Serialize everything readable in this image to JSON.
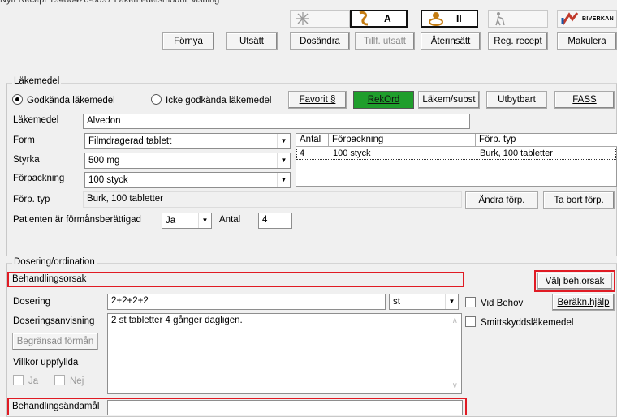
{
  "window": {
    "title": "Nytt Recept 19480420-0097 Läkemedelsmodul, visning"
  },
  "toolbar": {
    "icons": [
      {
        "name": "snowflake-icon",
        "label": ""
      },
      {
        "name": "person-a-icon",
        "label": "A"
      },
      {
        "name": "person-ii-icon",
        "label": "II"
      },
      {
        "name": "walker-icon",
        "label": ""
      },
      {
        "name": "biverkan-logo-icon",
        "label": "BIVERKAN"
      }
    ],
    "buttons": {
      "fornya": "Förnya",
      "utsatt": "Utsätt",
      "dosandra": "Dosändra",
      "tillf_utsatt": "Tillf. utsatt",
      "aterinsatt": "Återinsätt",
      "reg_recept": "Reg. recept",
      "makulera": "Makulera"
    }
  },
  "lakemedel": {
    "legend": "Läkemedel",
    "radio_godkanda": "Godkända läkemedel",
    "radio_icke": "Icke godkända läkemedel",
    "buttons": {
      "favorit": "Favorit §",
      "rekord": "RekOrd",
      "lakem_subst": "Läkem/subst",
      "utbytbart": "Utbytbart",
      "fass": "FASS",
      "andra_forp": "Ändra förp.",
      "ta_bort_forp": "Ta bort förp."
    },
    "labels": {
      "lakemedel": "Läkemedel",
      "form": "Form",
      "styrka": "Styrka",
      "forpackning": "Förpackning",
      "forp_typ": "Förp. typ",
      "formansberattigad": "Patienten är förmånsberättigad",
      "antal": "Antal"
    },
    "values": {
      "lakemedel": "Alvedon",
      "form": "Filmdragerad tablett",
      "styrka": "500 mg",
      "forpackning": "100 styck",
      "forp_typ": "Burk, 100 tabletter",
      "formansberattigad": "Ja",
      "antal": "4"
    },
    "grid": {
      "headers": [
        "Antal",
        "Förpackning",
        "Förp. typ"
      ],
      "rows": [
        [
          "4",
          "100 styck",
          "Burk, 100 tabletter"
        ]
      ]
    }
  },
  "dosering": {
    "legend": "Dosering/ordination",
    "labels": {
      "behandlingsorsak": "Behandlingsorsak",
      "dosering": "Dosering",
      "doseringsanvisning": "Doseringsanvisning",
      "villkor": "Villkor uppfyllda",
      "ja": "Ja",
      "nej": "Nej",
      "behandlingsandamal": "Behandlingsändamål",
      "vid_behov": "Vid Behov",
      "smittskydd": "Smittskyddsläkemedel"
    },
    "values": {
      "behandlingsorsak": "",
      "dosering": "2+2+2+2",
      "dos_unit": "st",
      "doseringsanvisning": "2 st tabletter 4 gånger dagligen.",
      "behandlingsandamal": ""
    },
    "buttons": {
      "valj_beh_orsak": "Välj beh.orsak",
      "berakn_hjalp": "Beräkn.hjälp",
      "begransad_forman": "Begränsad förmån"
    }
  },
  "highlight_color": "#e01b24",
  "rekord_color": "#1f9e2c"
}
